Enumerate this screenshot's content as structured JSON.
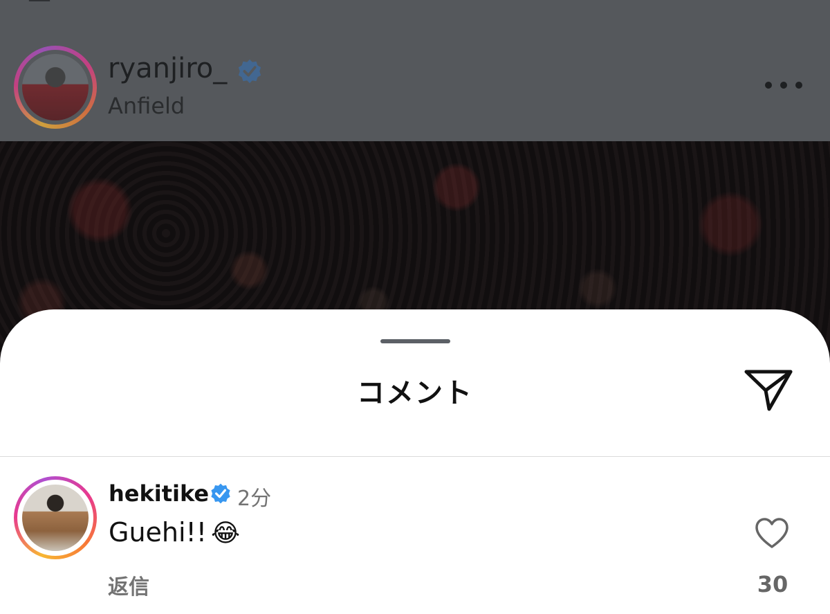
{
  "post": {
    "username": "ryanjiro_",
    "location": "Anfield",
    "verified_icon": "verified-badge-icon",
    "more_icon": "more-horizontal-icon"
  },
  "comments_sheet": {
    "title": "コメント",
    "share_icon": "send-icon"
  },
  "comments": [
    {
      "username": "hekitike",
      "time": "2分",
      "text": "Guehi!!",
      "emoji": "😂",
      "reply_label": "返信",
      "like_count": "30"
    }
  ],
  "colors": {
    "verified": "#3897f0",
    "story_ring": [
      "#f7b733",
      "#e8398e",
      "#b04fd0"
    ]
  }
}
